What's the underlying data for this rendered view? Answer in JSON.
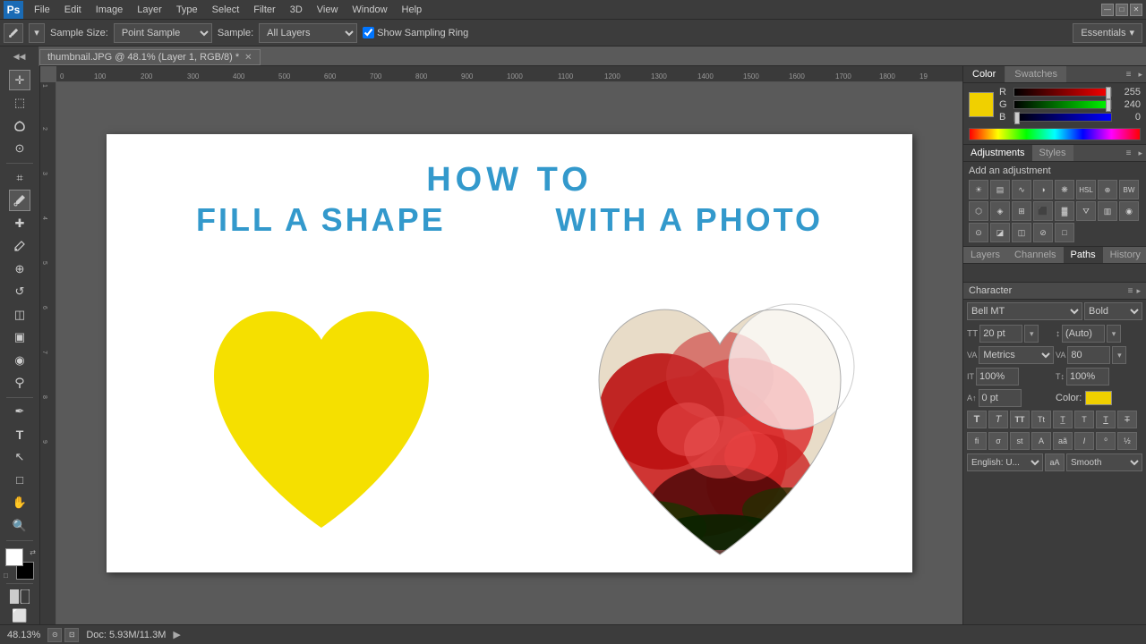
{
  "app": {
    "title": "Adobe Photoshop",
    "icon": "Ps"
  },
  "menu": {
    "items": [
      "File",
      "Edit",
      "Image",
      "Layer",
      "Type",
      "Select",
      "Filter",
      "3D",
      "View",
      "Window",
      "Help"
    ]
  },
  "toolbar": {
    "sample_size_label": "Sample Size:",
    "sample_size_value": "Point Sample",
    "sample_label": "Sample:",
    "sample_value": "All Layers",
    "show_sampling_ring": "Show Sampling Ring",
    "essentials": "Essentials"
  },
  "document": {
    "tab_label": "thumbnail.JPG @ 48.1% (Layer 1, RGB/8) *"
  },
  "canvas": {
    "title_line1": "HOW TO",
    "title_line2_left": "FILL  A  SHAPE",
    "title_line2_right": "WITH  A  PHOTO"
  },
  "color_panel": {
    "tabs": [
      "Color",
      "Swatches"
    ],
    "active_tab": "Color",
    "r_label": "R",
    "g_label": "G",
    "b_label": "B",
    "r_value": "255",
    "g_value": "240",
    "b_value": "0"
  },
  "adjustments_panel": {
    "tabs": [
      "Adjustments",
      "Styles"
    ],
    "active_tab": "Adjustments",
    "add_adjustment": "Add an adjustment"
  },
  "layers_panel": {
    "tabs": [
      "Layers",
      "Channels",
      "Paths",
      "History"
    ],
    "active_tab": "Paths"
  },
  "character_panel": {
    "title": "Character",
    "font_family": "Bell MT",
    "font_style": "Bold",
    "font_size": "20 pt",
    "leading": "(Auto)",
    "kerning": "Metrics",
    "tracking": "80",
    "horizontal_scale": "100%",
    "vertical_scale": "100%",
    "baseline_shift": "0 pt",
    "color_label": "Color:",
    "language": "English: U...",
    "anti_alias": "Smooth",
    "text_buttons": [
      "T",
      "T",
      "TT",
      "Tt",
      "T̲",
      "T",
      "T",
      "T"
    ],
    "figs_buttons": [
      "fi",
      "σ",
      "st",
      "A",
      "aã",
      "I",
      "⁰",
      "½"
    ]
  },
  "status_bar": {
    "zoom": "48.13%",
    "doc_size": "Doc: 5.93M/11.3M"
  }
}
